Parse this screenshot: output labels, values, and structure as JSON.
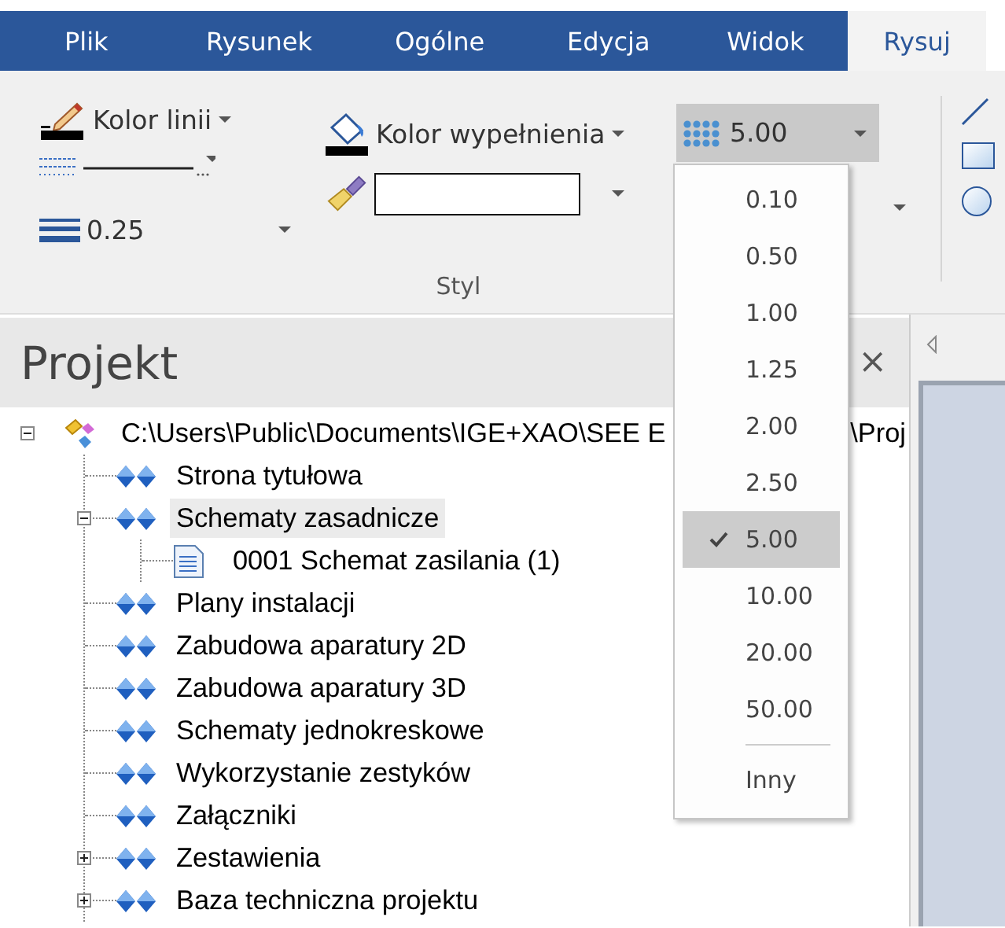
{
  "tabs": [
    {
      "label": "Plik",
      "selected": false
    },
    {
      "label": "Rysunek",
      "selected": false
    },
    {
      "label": "Ogólne",
      "selected": false
    },
    {
      "label": "Edycja",
      "selected": false
    },
    {
      "label": "Widok",
      "selected": false
    },
    {
      "label": "Rysuj",
      "selected": true
    }
  ],
  "ribbon": {
    "line_color_label": "Kolor linii",
    "line_width_value": "0.25",
    "fill_color_label": "Kolor wypełnienia",
    "grid_size": {
      "value": "5.00",
      "expanded": true
    },
    "group_label": "Styl"
  },
  "grid_size_menu": {
    "items": [
      {
        "label": "0.10",
        "selected": false
      },
      {
        "label": "0.50",
        "selected": false
      },
      {
        "label": "1.00",
        "selected": false
      },
      {
        "label": "1.25",
        "selected": false
      },
      {
        "label": "2.00",
        "selected": false
      },
      {
        "label": "2.50",
        "selected": false
      },
      {
        "label": "5.00",
        "selected": true
      },
      {
        "label": "10.00",
        "selected": false
      },
      {
        "label": "20.00",
        "selected": false
      },
      {
        "label": "50.00",
        "selected": false
      }
    ],
    "other_label": "Inny"
  },
  "project_panel": {
    "title": "Projekt",
    "close_glyph": "×",
    "tree": {
      "label": "C:\\Users\\Public\\Documents\\IGE+XAO\\SEE E",
      "label_tail": "\\Proj",
      "kind": "project",
      "expanded": true,
      "selected": false,
      "children": [
        {
          "label": "Strona tytułowa",
          "kind": "folder",
          "selected": false
        },
        {
          "label": "Schematy zasadnicze",
          "kind": "folder",
          "selected": true,
          "expanded": true,
          "children": [
            {
              "label": "0001 Schemat zasilania (1)",
              "kind": "document",
              "selected": false
            }
          ]
        },
        {
          "label": "Plany instalacji",
          "kind": "folder",
          "selected": false
        },
        {
          "label": "Zabudowa aparatury 2D",
          "kind": "folder",
          "selected": false
        },
        {
          "label": "Zabudowa aparatury 3D",
          "kind": "folder",
          "selected": false
        },
        {
          "label": "Schematy jednokreskowe",
          "kind": "folder",
          "selected": false
        },
        {
          "label": "Wykorzystanie zestyków",
          "kind": "folder",
          "selected": false
        },
        {
          "label": "Załączniki",
          "kind": "folder",
          "selected": false
        },
        {
          "label": "Zestawienia",
          "kind": "folder",
          "selected": false,
          "expanded": false
        },
        {
          "label": "Baza techniczna projektu",
          "kind": "folder",
          "selected": false,
          "expanded": false
        }
      ]
    }
  }
}
